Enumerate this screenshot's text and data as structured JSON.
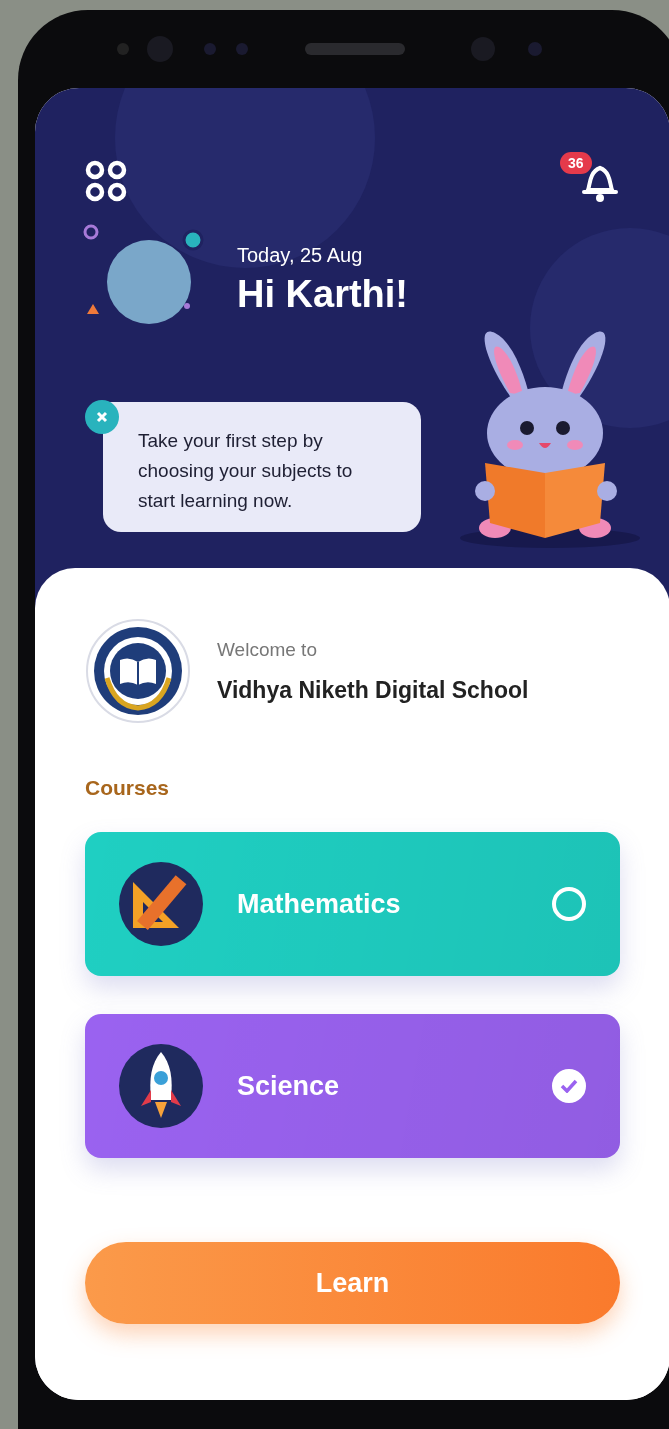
{
  "header": {
    "notification_count": "36",
    "date": "Today, 25 Aug",
    "greeting": "Hi Karthi!"
  },
  "tip": {
    "text": "Take your first step by choosing your subjects to start learning now."
  },
  "school": {
    "welcome": "Welcome to",
    "name": "Vidhya Niketh Digital School"
  },
  "courses": {
    "title": "Courses",
    "items": [
      {
        "name": "Mathematics",
        "kind": "math",
        "color": "#1fcfc2",
        "selected": false
      },
      {
        "name": "Science",
        "kind": "science",
        "color": "#9a62f0",
        "selected": true
      }
    ]
  },
  "learn_button": {
    "label": "Learn"
  }
}
